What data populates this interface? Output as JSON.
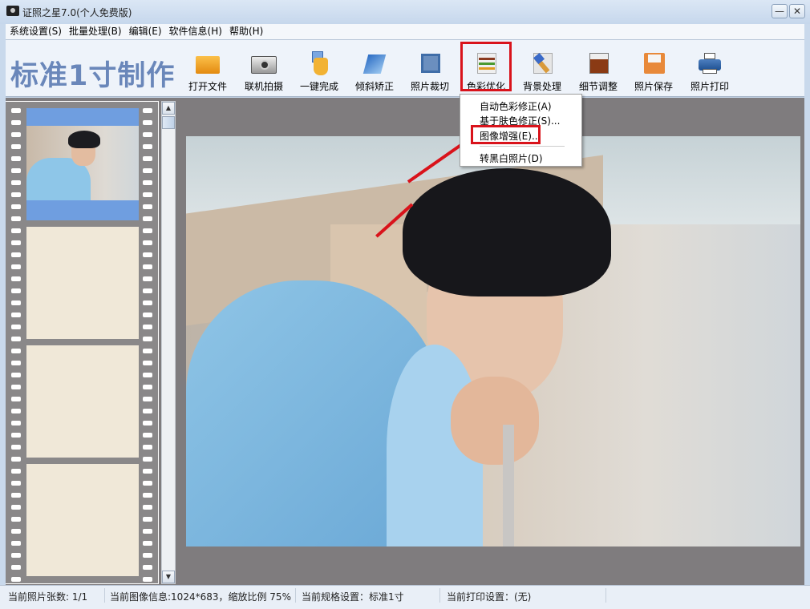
{
  "window": {
    "title": "证照之星7.0(个人免费版)",
    "minimize": "—",
    "close": "✕"
  },
  "menubar": [
    "系统设置(S)",
    "批量处理(B)",
    "编辑(E)",
    "软件信息(H)",
    "帮助(H)"
  ],
  "toolbar": {
    "heading": "标准1寸制作",
    "buttons": [
      {
        "label": "打开文件",
        "icon": "folder-icon"
      },
      {
        "label": "联机拍摄",
        "icon": "camera-icon"
      },
      {
        "label": "一键完成",
        "icon": "hand-pointer-icon"
      },
      {
        "label": "倾斜矫正",
        "icon": "rotate-icon"
      },
      {
        "label": "照片裁切",
        "icon": "crop-icon"
      },
      {
        "label": "色彩优化",
        "icon": "color-sliders-icon"
      },
      {
        "label": "背景处理",
        "icon": "brush-icon"
      },
      {
        "label": "细节调整",
        "icon": "histogram-icon"
      },
      {
        "label": "照片保存",
        "icon": "floppy-icon"
      },
      {
        "label": "照片打印",
        "icon": "printer-icon"
      }
    ]
  },
  "dropdown": {
    "items": [
      "自动色彩修正(A)",
      "基于肤色修正(S)...",
      "图像增强(E)...",
      "转黑白照片(D)"
    ],
    "highlighted": "图像增强(E)..."
  },
  "status": {
    "count": "当前照片张数: 1/1",
    "info": "当前图像信息:1024*683，缩放比例 75%",
    "spec": "当前规格设置：标准1寸",
    "print": "当前打印设置：(无)"
  },
  "colors": {
    "highlight": "#d9131b",
    "heading": "#6a87ba",
    "selected_frame": "#6f9ee0"
  }
}
